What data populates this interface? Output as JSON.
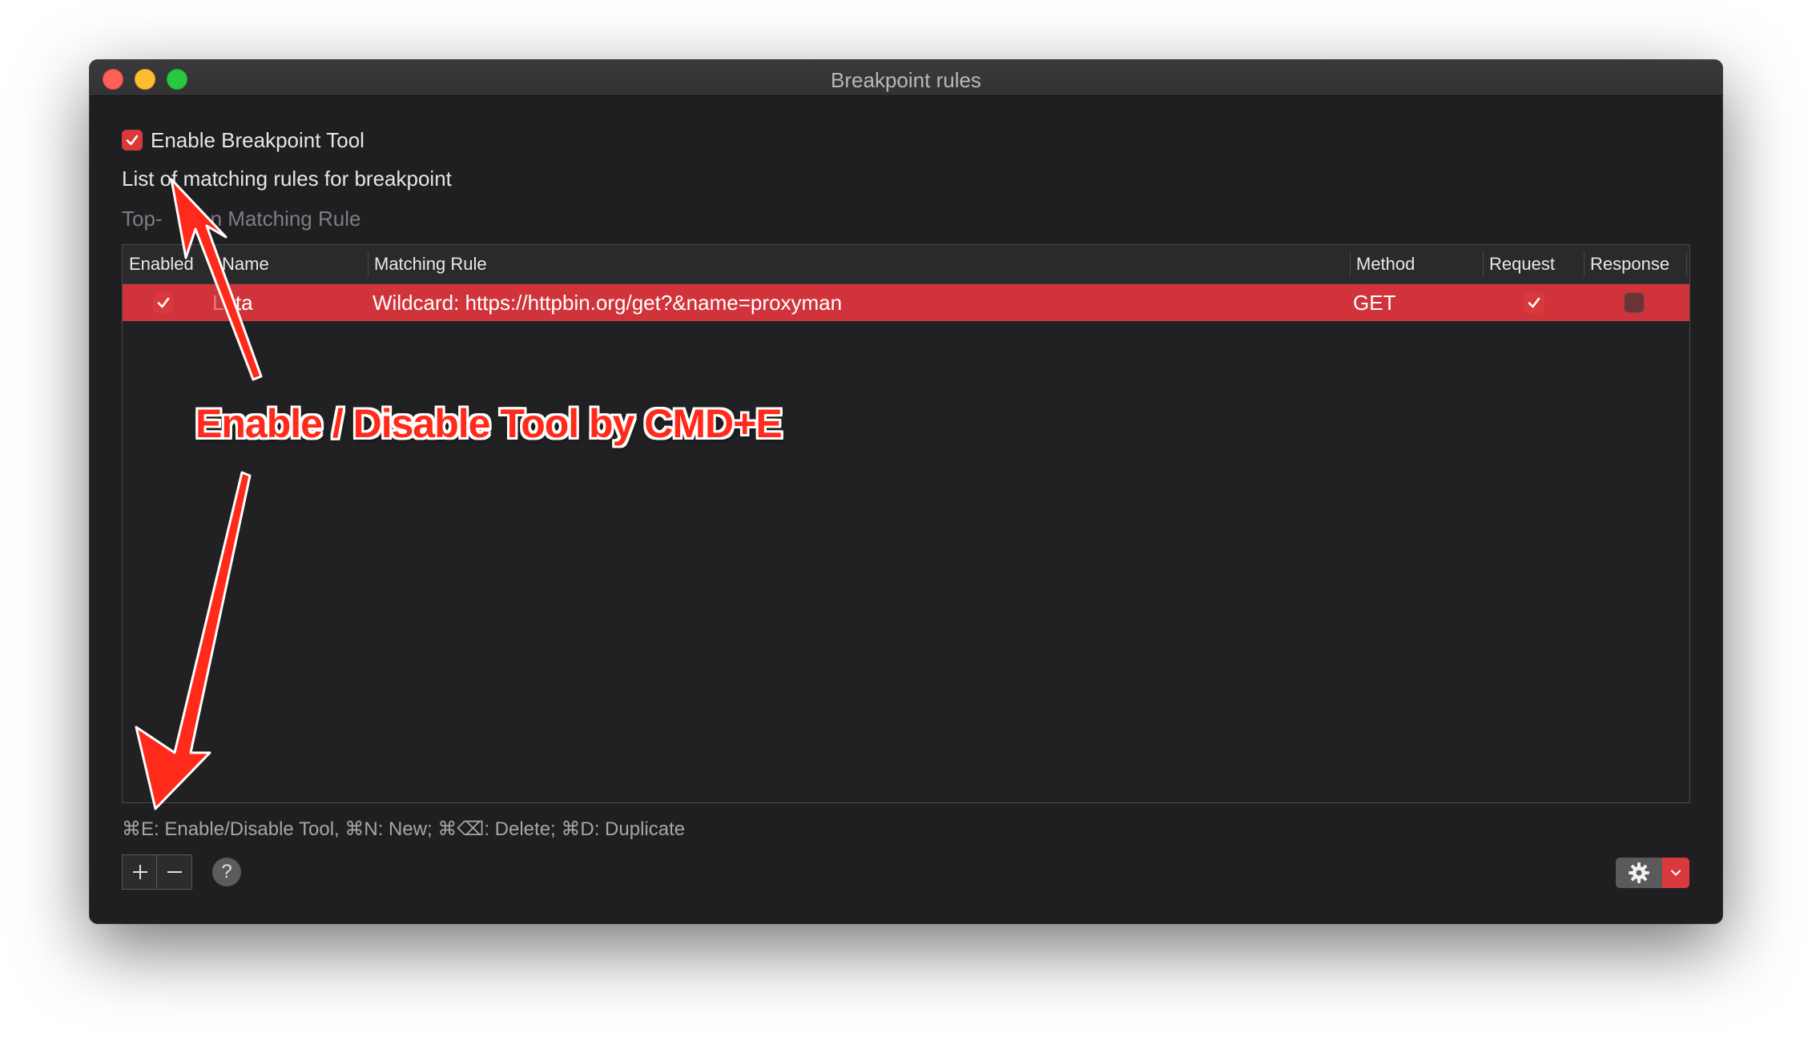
{
  "window": {
    "title": "Breakpoint rules"
  },
  "settings": {
    "enable_tool_label": "Enable Breakpoint Tool",
    "enable_tool_checked": true,
    "list_heading": "List of matching rules for breakpoint",
    "hint_visible": "Top-",
    "hint_visible_2": "n Matching Rule"
  },
  "table": {
    "columns": [
      "Enabled",
      "Name",
      "Matching Rule",
      "Method",
      "Request",
      "Response"
    ],
    "rows": [
      {
        "enabled": true,
        "name": "Data",
        "name_visible": "ata",
        "name_partial": "L",
        "matching_rule": "Wildcard: https://httpbin.org/get?&name=proxyman",
        "method": "GET",
        "request": true,
        "response": false,
        "selected": true
      }
    ]
  },
  "footer": {
    "shortcuts": "⌘E: Enable/Disable Tool, ⌘N: New; ⌘⌫: Delete; ⌘D: Duplicate",
    "add_icon": "plus-icon",
    "remove_icon": "minus-icon",
    "help_label": "?",
    "settings_icon": "gear-icon",
    "dropdown_icon": "chevron-down-icon"
  },
  "annotation": {
    "text": "Enable / Disable Tool by CMD+E",
    "color": "#ff2a1a"
  },
  "colors": {
    "accent": "#d9393c",
    "selected_row": "#d0343a",
    "window_bg": "#1f1f21"
  }
}
